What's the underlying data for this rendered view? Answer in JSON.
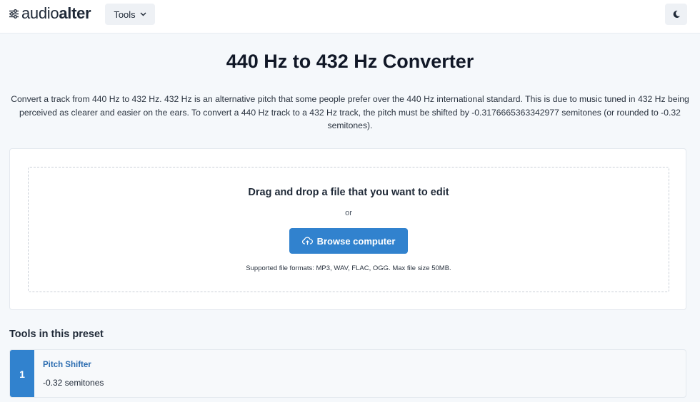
{
  "header": {
    "logo_audio": "audio",
    "logo_alter": "alter",
    "tools_label": "Tools"
  },
  "page": {
    "title": "440 Hz to 432 Hz Converter",
    "description": "Convert a track from 440 Hz to 432 Hz. 432 Hz is an alternative pitch that some people prefer over the 440 Hz international standard. This is due to music tuned in 432 Hz being perceived as clearer and easier on the ears. To convert a 440 Hz track to a 432 Hz track, the pitch must be shifted by -0.3176665363342977 semitones (or rounded to -0.32 semitones)."
  },
  "upload": {
    "drop_title": "Drag and drop a file that you want to edit",
    "or_text": "or",
    "browse_label": "Browse computer",
    "formats_text": "Supported file formats: MP3, WAV, FLAC, OGG. Max file size 50MB."
  },
  "preset": {
    "section_title": "Tools in this preset",
    "tools": [
      {
        "number": "1",
        "name": "Pitch Shifter",
        "value": "-0.32 semitones"
      }
    ]
  },
  "colors": {
    "accent": "#3182ce",
    "link": "#2b6cb0",
    "background": "#f5f8fb"
  },
  "icons": {
    "logo": "sliders-icon",
    "tools_dropdown": "chevron-down-icon",
    "theme": "moon-icon",
    "browse": "cloud-upload-icon"
  }
}
